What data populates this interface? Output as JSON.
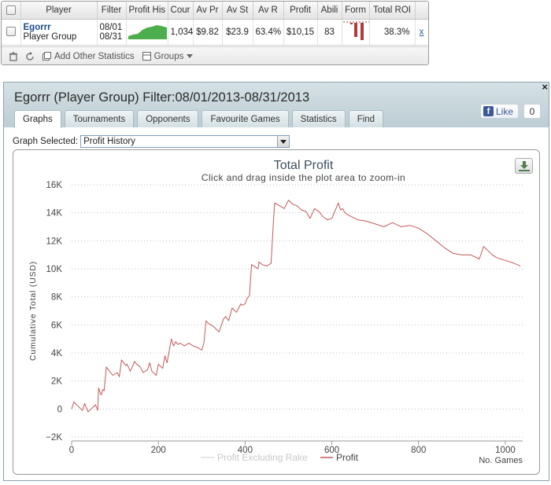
{
  "grid": {
    "headers": [
      "Player",
      "Filter",
      "Profit His",
      "Cour",
      "Av Pr",
      "Av St",
      "Av R",
      "Profit",
      "Abili",
      "Form",
      "Total ROI"
    ],
    "row": {
      "player_name": "Egorrr",
      "player_group": "Player Group",
      "filter_line1": "08/01",
      "filter_line2": "08/31",
      "count": "1,034",
      "av_profit": "$9.82",
      "av_stake": "$23.9",
      "av_roi": "63.4%",
      "profit": "$10,15",
      "ability": "83",
      "total_roi": "38.3%",
      "remove": "x"
    },
    "footer": {
      "add_stats": "Add Other Statistics",
      "groups": "Groups"
    },
    "colors": {
      "sparkline": "#4cae4c",
      "form": "#b03a3a"
    }
  },
  "panel": {
    "title": "Egorrr (Player Group) Filter:08/01/2013-08/31/2013",
    "close": "×",
    "facebook": {
      "like": "Like",
      "count": "0"
    },
    "tabs": [
      "Graphs",
      "Tournaments",
      "Opponents",
      "Favourite Games",
      "Statistics",
      "Find"
    ],
    "active_tab": "Graphs",
    "graph_selected_label": "Graph Selected:",
    "graph_selected_value": "Profit History"
  },
  "chart_data": {
    "type": "line",
    "title": "Total Profit",
    "subtitle": "Click and drag inside the plot area to zoom-in",
    "xlabel": "No. Games",
    "ylabel": "Cumulative Total (USD)",
    "xlim": [
      0,
      1040
    ],
    "ylim": [
      -2000,
      16000
    ],
    "x_ticks": [
      0,
      200,
      400,
      600,
      800,
      1000
    ],
    "y_ticks": [
      -2000,
      0,
      2000,
      4000,
      6000,
      8000,
      10000,
      12000,
      14000,
      16000
    ],
    "x_tick_labels": [
      "0",
      "200",
      "400",
      "600",
      "800",
      "1000"
    ],
    "y_tick_labels": [
      "−2K",
      "0",
      "2K",
      "4K",
      "6K",
      "8K",
      "10K",
      "12K",
      "14K",
      "16K"
    ],
    "grid": "horizontal dotted",
    "legend_position": "bottom-center",
    "series": [
      {
        "name": "Profit Excluding Rake",
        "color": "#dddddd",
        "x": [],
        "y": []
      },
      {
        "name": "Profit",
        "color": "#c25a5a",
        "x": [
          0,
          5,
          15,
          25,
          30,
          35,
          38,
          55,
          60,
          62,
          68,
          72,
          75,
          80,
          85,
          95,
          105,
          110,
          115,
          125,
          128,
          135,
          140,
          145,
          150,
          158,
          165,
          175,
          180,
          185,
          195,
          200,
          210,
          215,
          220,
          230,
          235,
          240,
          245,
          250,
          260,
          270,
          280,
          290,
          300,
          305,
          310,
          315,
          322,
          330,
          340,
          350,
          355,
          362,
          370,
          380,
          390,
          393,
          400,
          405,
          410,
          415,
          425,
          430,
          432,
          440,
          450,
          460,
          465,
          468,
          480,
          490,
          500,
          510,
          520,
          530,
          540,
          550,
          560,
          570,
          580,
          590,
          600,
          615,
          620,
          625,
          630,
          640,
          660,
          680,
          700,
          720,
          740,
          760,
          780,
          800,
          820,
          840,
          860,
          880,
          900,
          920,
          940,
          950,
          960,
          970,
          980,
          1000,
          1020,
          1035
        ],
        "y": [
          0,
          500,
          200,
          -100,
          400,
          0,
          -200,
          300,
          -100,
          1500,
          1000,
          1400,
          1300,
          3000,
          2800,
          2400,
          2600,
          2300,
          3500,
          3100,
          3200,
          2700,
          3000,
          3400,
          3200,
          3000,
          2600,
          2800,
          3300,
          2700,
          2400,
          3200,
          2900,
          3800,
          3300,
          5000,
          4500,
          4800,
          4600,
          4700,
          4500,
          4700,
          4500,
          4400,
          4200,
          4700,
          6300,
          6100,
          6000,
          5800,
          5500,
          6400,
          6600,
          6300,
          7200,
          6900,
          7500,
          7400,
          7500,
          7900,
          8100,
          10300,
          10100,
          10000,
          10500,
          10300,
          10200,
          10400,
          13200,
          14700,
          14500,
          14300,
          14900,
          14600,
          14500,
          14200,
          14100,
          13600,
          14300,
          14100,
          13700,
          13500,
          13600,
          14700,
          14200,
          14300,
          14000,
          13800,
          13500,
          13400,
          13200,
          13000,
          13300,
          13000,
          13100,
          12900,
          12500,
          12000,
          11500,
          11100,
          11000,
          11000,
          10700,
          11600,
          11300,
          11000,
          10800,
          10600,
          10400,
          10200
        ]
      }
    ]
  }
}
